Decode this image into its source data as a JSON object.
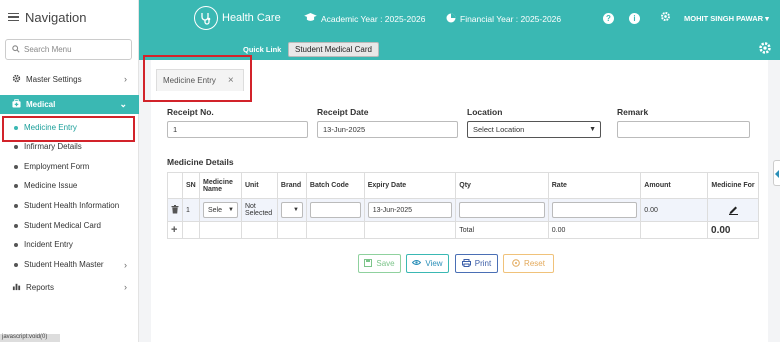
{
  "sidebar": {
    "title": "Navigation",
    "search_placeholder": "Search Menu",
    "items": [
      {
        "label": "Master Settings"
      },
      {
        "label": "Medical"
      },
      {
        "label": "Reports"
      }
    ],
    "medical_sub": [
      {
        "label": "Medicine Entry"
      },
      {
        "label": "Infirmary Details"
      },
      {
        "label": "Employment Form"
      },
      {
        "label": "Medicine Issue"
      },
      {
        "label": "Student Health Information"
      },
      {
        "label": "Student Medical Card"
      },
      {
        "label": "Incident Entry"
      },
      {
        "label": "Student Health Master"
      }
    ]
  },
  "topbar": {
    "brand": "Health Care",
    "academic_year": "Academic Year : 2025-2026",
    "financial_year": "Financial Year : 2025-2026",
    "user": "MOHIT SINGH PAWAR",
    "help_glyph": "?",
    "info_glyph": "i"
  },
  "quicklink": {
    "label": "Quick Link",
    "button": "Student Medical Card"
  },
  "tab": {
    "label": "Medicine Entry",
    "close": "×"
  },
  "form": {
    "receipt_no_label": "Receipt No.",
    "receipt_no_value": "1",
    "receipt_date_label": "Receipt Date",
    "receipt_date_value": "13-Jun-2025",
    "location_label": "Location",
    "location_value": "Select Location",
    "remark_label": "Remark",
    "remark_value": ""
  },
  "details": {
    "section_title": "Medicine Details",
    "headers": [
      "SN",
      "Medicine Name",
      "Unit",
      "Brand",
      "Batch Code",
      "Expiry Date",
      "Qty",
      "Rate",
      "Amount",
      "Medicine For"
    ],
    "row": {
      "sn": "1",
      "medicine_name": "Sele",
      "unit": "Not Selected",
      "brand": "",
      "batch_code": "",
      "expiry_date": "13-Jun-2025",
      "qty": "",
      "rate": "",
      "amount": "0.00"
    },
    "total_label": "Total",
    "total_rate": "0.00",
    "total_amount": "0.00"
  },
  "buttons": {
    "save": "Save",
    "view": "View",
    "print": "Print",
    "reset": "Reset"
  },
  "status_text": "javascript:void(0)",
  "colors": {
    "accent": "#3ab8b3",
    "annotation_red": "#d2232a"
  }
}
